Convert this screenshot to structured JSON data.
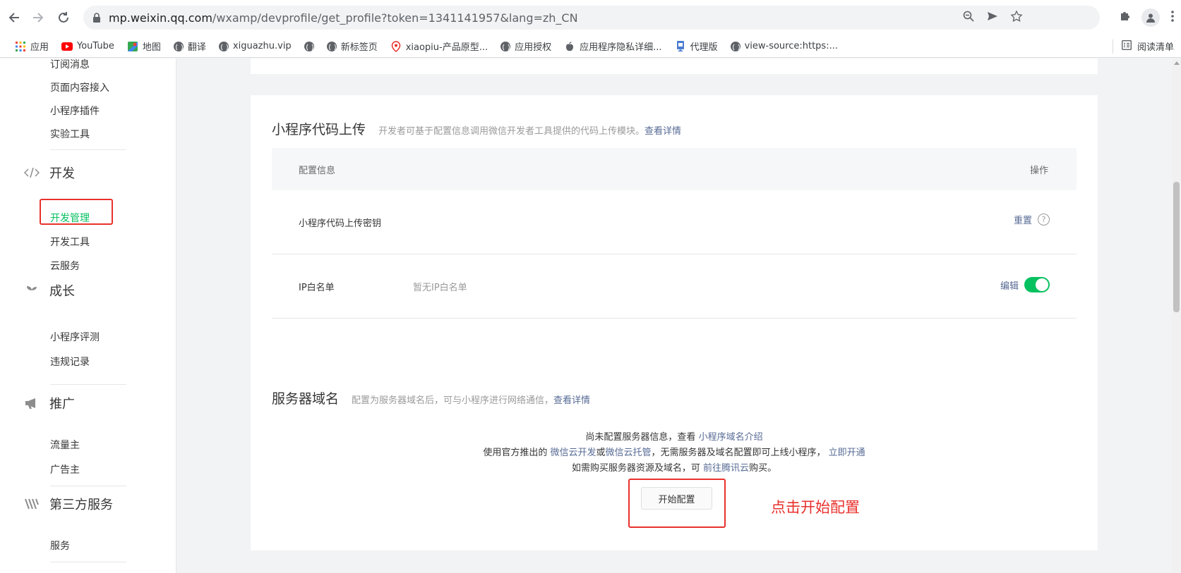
{
  "browser": {
    "url_host": "mp.weixin.qq.com",
    "url_path": "/wxamp/devprofile/get_profile?token=1341141957&lang=zh_CN",
    "bookmarks": [
      {
        "label": "应用",
        "icon": "apps-grid-icon"
      },
      {
        "label": "YouTube",
        "icon": "youtube-icon"
      },
      {
        "label": "地图",
        "icon": "maps-icon"
      },
      {
        "label": "翻译",
        "icon": "globe-icon"
      },
      {
        "label": "xiguazhu.vip",
        "icon": "globe-icon"
      },
      {
        "label": "",
        "icon": "globe-icon"
      },
      {
        "label": "新标签页",
        "icon": "globe-icon"
      },
      {
        "label": "xiaopiu-产品原型...",
        "icon": "pin-icon"
      },
      {
        "label": "应用授权",
        "icon": "globe-icon"
      },
      {
        "label": "应用程序隐私详细...",
        "icon": "apple-icon"
      },
      {
        "label": "代理版",
        "icon": "bookmark-icon"
      },
      {
        "label": "view-source:https:...",
        "icon": "globe-icon"
      }
    ],
    "reading_list": "阅读清单"
  },
  "sidebar": {
    "items_top": [
      "订阅消息",
      "页面内容接入",
      "小程序插件",
      "实验工具"
    ],
    "dev_group": "开发",
    "dev_items": [
      "开发管理",
      "开发工具",
      "云服务"
    ],
    "growth_group": "成长",
    "growth_items": [
      "小程序评测",
      "违规记录"
    ],
    "promo_group": "推广",
    "promo_items": [
      "流量主",
      "广告主"
    ],
    "third_group": "第三方服务",
    "third_items": [
      "服务"
    ]
  },
  "upload_card": {
    "title": "小程序代码上传",
    "desc": "开发者可基于配置信息调用微信开发者工具提供的代码上传模块。",
    "desc_link": "查看详情",
    "col_config": "配置信息",
    "col_action": "操作",
    "row_secret_label": "小程序代码上传密钥",
    "row_secret_action": "重置",
    "row_ip_label": "IP白名单",
    "row_ip_value": "暂无IP白名单",
    "row_ip_action": "编辑"
  },
  "domain_card": {
    "title": "服务器域名",
    "desc": "配置为服务器域名后，可与小程序进行网络通信，",
    "desc_link": "查看详情",
    "line1_a": "尚未配置服务器信息，查看 ",
    "line1_link": "小程序域名介绍",
    "line2_a": "使用官方推出的 ",
    "line2_link1": "微信云开发",
    "line2_b": "或",
    "line2_link2": "微信云托管",
    "line2_c": "，无需服务器及域名配置即可上线小程序，  ",
    "line2_link3": "立即开通",
    "line3_a": "如需购买服务器资源及域名，可 ",
    "line3_link": "前往腾讯云",
    "line3_b": "购买。",
    "start_button": "开始配置",
    "annotation": "点击开始配置"
  },
  "colors": {
    "accent_green": "#07c160",
    "link_blue": "#576b95",
    "annotation_red": "#e8312c"
  }
}
